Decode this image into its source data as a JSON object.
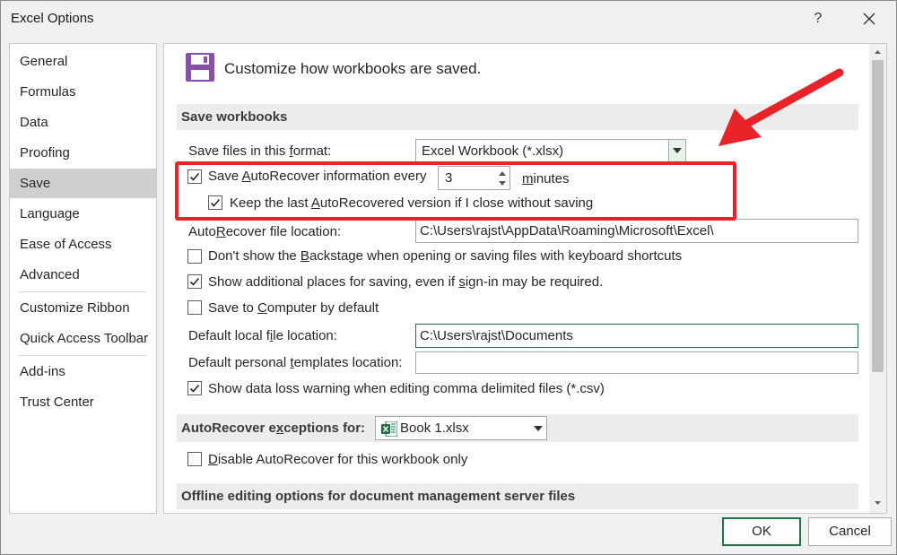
{
  "window": {
    "title": "Excel Options",
    "help_label": "?"
  },
  "sidebar": {
    "items": [
      {
        "label": "General"
      },
      {
        "label": "Formulas"
      },
      {
        "label": "Data"
      },
      {
        "label": "Proofing"
      },
      {
        "label": "Save",
        "selected": true
      },
      {
        "label": "Language"
      },
      {
        "label": "Ease of Access"
      },
      {
        "label": "Advanced"
      },
      {
        "label": "Customize Ribbon"
      },
      {
        "label": "Quick Access Toolbar"
      },
      {
        "label": "Add-ins"
      },
      {
        "label": "Trust Center"
      }
    ]
  },
  "main": {
    "header_text": "Customize how workbooks are saved.",
    "save_workbooks": {
      "section_title": "Save workbooks",
      "format_label_pre": "Save files in this ",
      "format_label_u": "f",
      "format_label_post": "ormat:",
      "format_value": "Excel Workbook (*.xlsx)",
      "autorecover_pre": "Save ",
      "autorecover_u": "A",
      "autorecover_post": "utoRecover information every",
      "autorecover_checked": true,
      "autorecover_minutes": "3",
      "minutes_u": "m",
      "minutes_post": "inutes",
      "keep_pre": "Keep the last ",
      "keep_u": "A",
      "keep_post": "utoRecovered version if I close without saving",
      "keep_checked": true,
      "location_pre": "Auto",
      "location_u": "R",
      "location_post": "ecover file location:",
      "location_value": "C:\\Users\\rajst\\AppData\\Roaming\\Microsoft\\Excel\\",
      "backstage_pre": "Don't show the ",
      "backstage_u": "B",
      "backstage_post": "ackstage when opening or saving files with keyboard shortcuts",
      "backstage_checked": false,
      "additional_pre": "Show additional places for saving, even if ",
      "additional_u": "s",
      "additional_post": "ign-in may be required.",
      "additional_checked": true,
      "computer_pre": "Save to ",
      "computer_u": "C",
      "computer_post": "omputer by default",
      "computer_checked": false,
      "default_local_pre": "Default local f",
      "default_local_u": "i",
      "default_local_post": "le location:",
      "default_local_value": "C:\\Users\\rajst\\Documents",
      "templates_pre": "Default personal ",
      "templates_u": "t",
      "templates_post": "emplates location:",
      "templates_value": "",
      "dataloss_label": "Show data loss warning when editing comma delimited files (*.csv)",
      "dataloss_checked": true
    },
    "exceptions": {
      "section_pre": "AutoRecover e",
      "section_u": "x",
      "section_post": "ceptions for:",
      "workbook_value": "Book 1.xlsx",
      "disable_pre": "",
      "disable_u": "D",
      "disable_post": "isable AutoRecover for this workbook only",
      "disable_checked": false
    },
    "offline": {
      "section_title": "Offline editing options for document management server files"
    }
  },
  "footer": {
    "ok_label": "OK",
    "cancel_label": "Cancel"
  },
  "colors": {
    "accent": "#217346",
    "highlight": "#e8242a",
    "selected_nav": "#cfcfcf"
  }
}
